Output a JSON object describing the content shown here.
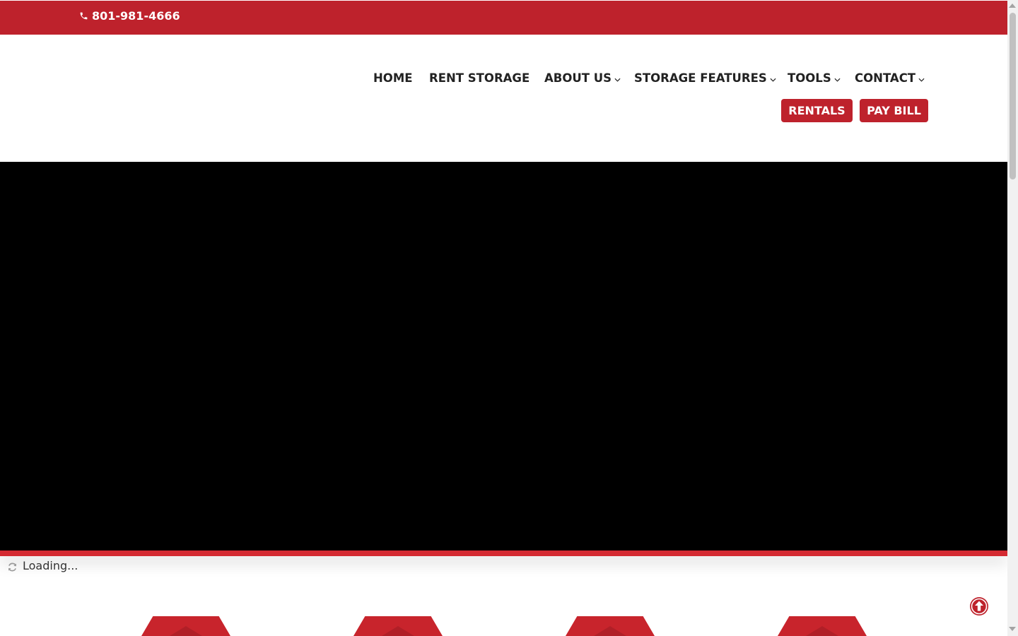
{
  "topbar": {
    "phone": "801-981-4666",
    "color": "#be222c"
  },
  "nav": {
    "items": [
      {
        "label": "HOME",
        "dropdown": false
      },
      {
        "label": "RENT STORAGE",
        "dropdown": false
      },
      {
        "label": "ABOUT US",
        "dropdown": true
      },
      {
        "label": "STORAGE FEATURES",
        "dropdown": true
      },
      {
        "label": "TOOLS",
        "dropdown": true
      },
      {
        "label": "CONTACT",
        "dropdown": true
      }
    ],
    "buttons": {
      "rentals": "RENTALS",
      "pay_bill": "PAY BILL"
    }
  },
  "hero": {
    "background": "#000000",
    "accent": "#d42a31"
  },
  "loading": {
    "text": "Loading...",
    "icon": "refresh-icon"
  },
  "icons": {
    "phone": "phone-icon",
    "dropdown": "chevron-down-icon",
    "back_to_top": "arrow-up-circle-icon"
  }
}
